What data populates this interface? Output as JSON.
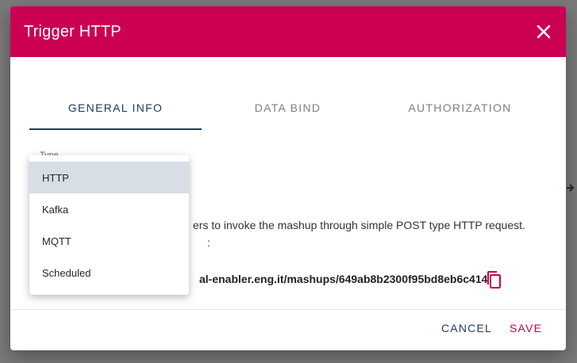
{
  "dialog": {
    "title": "Trigger HTTP"
  },
  "tabs": [
    {
      "label": "GENERAL INFO",
      "active": true
    },
    {
      "label": "DATA BIND",
      "active": false
    },
    {
      "label": "AUTHORIZATION",
      "active": false
    }
  ],
  "form": {
    "type_label": "Type",
    "description_line1": "ers to invoke the mashup through simple POST type HTTP request.",
    "description_line2": ":",
    "url": "al-enabler.eng.it/mashups/649ab8b2300f95bd8eb6c414"
  },
  "dropdown": {
    "options": [
      "HTTP",
      "Kafka",
      "MQTT",
      "Scheduled"
    ],
    "selected": "HTTP"
  },
  "footer": {
    "cancel_label": "CANCEL",
    "save_label": "SAVE"
  },
  "colors": {
    "accent": "#cc0052",
    "primary": "#1f3a5a",
    "selected_bg": "#d7dee6"
  },
  "icons": {
    "close": "close-icon",
    "copy": "copy-icon",
    "arrow": "arrow-right-icon"
  }
}
